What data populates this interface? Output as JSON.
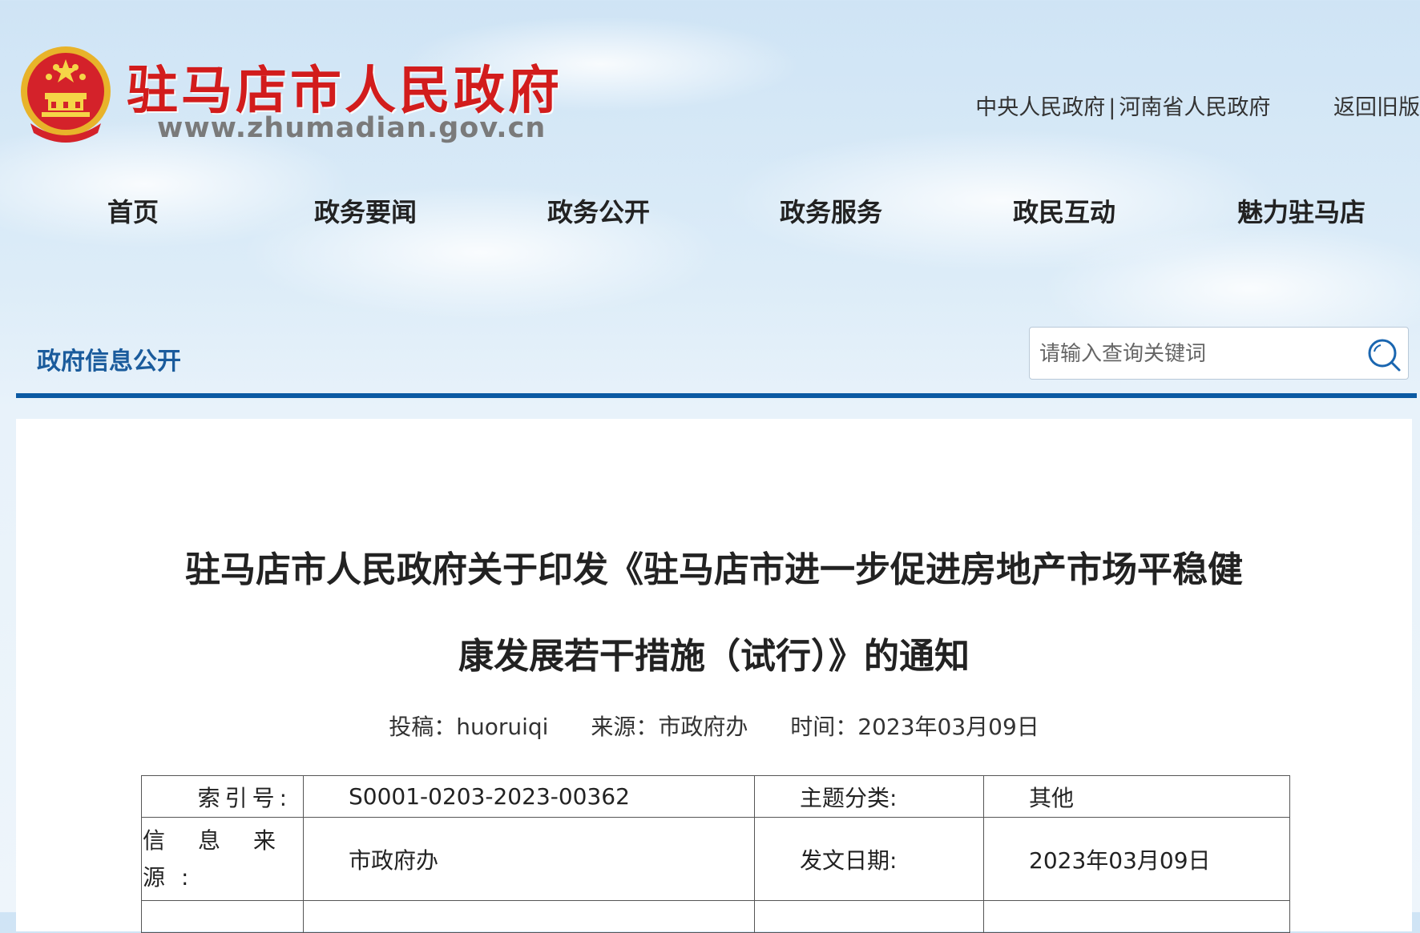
{
  "header": {
    "site_name": "驻马店市人民政府",
    "site_url": "www.zhumadian.gov.cn",
    "top_links": [
      "中央人民政府",
      "河南省人民政府"
    ],
    "top_separator": "|",
    "old_version": "返回旧版"
  },
  "nav": {
    "items": [
      "首页",
      "政务要闻",
      "政务公开",
      "政务服务",
      "政民互动",
      "魅力驻马店"
    ]
  },
  "section": {
    "title": "政府信息公开"
  },
  "search": {
    "placeholder": "请输入查询关键词",
    "icon": "search-icon"
  },
  "article": {
    "title_line1": "驻马店市人民政府关于印发《驻马店市进一步促进房地产市场平稳健",
    "title_line2": "康发展若干措施（试行）》的通知",
    "meta": {
      "author": "投稿：huoruiqi",
      "source": "来源：市政府办",
      "time": "时间：2023年03月09日"
    }
  },
  "info_table": {
    "rows": [
      {
        "label1": "索引号:",
        "value1": "S0001-0203-2023-00362",
        "label2": "主题分类:",
        "value2": "其他"
      },
      {
        "label1": "信息来源:",
        "value1": "市政府办",
        "label2": "发文日期:",
        "value2": "2023年03月09日"
      }
    ]
  },
  "colors": {
    "brand_red": "#d21c1c",
    "accent_blue": "#0b5aa3",
    "section_blue": "#1a5b9c"
  }
}
